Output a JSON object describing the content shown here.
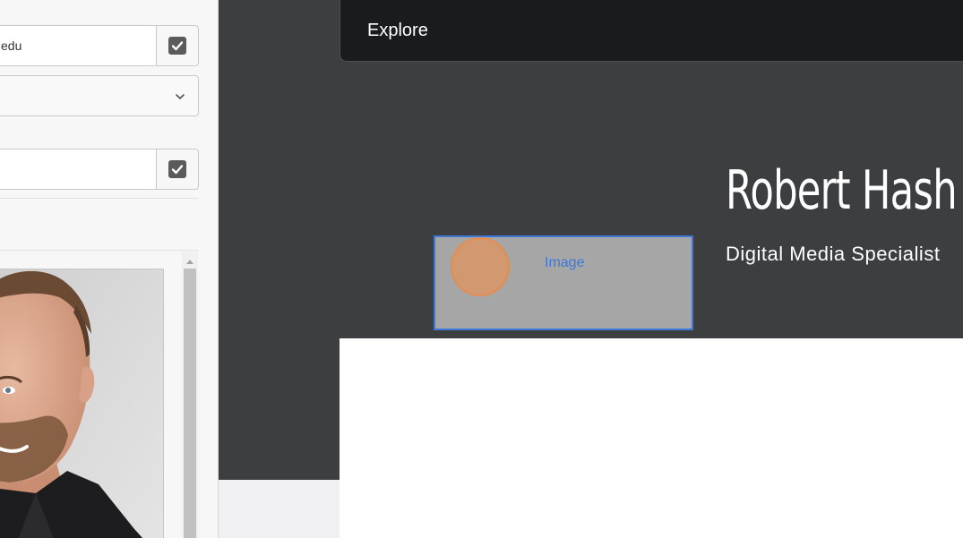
{
  "editor": {
    "email_field": {
      "value": "edu"
    },
    "second_field": {
      "value": ""
    },
    "photo": {
      "alt": "Profile photo of Robert"
    }
  },
  "preview": {
    "nav": {
      "label": "Explore"
    },
    "image_placeholder": {
      "label": "Image"
    },
    "profile": {
      "name": "Robert Hash",
      "title": "Digital Media Specialist"
    }
  },
  "colors": {
    "dark_bg": "#3d3e40",
    "nav_bg": "#1a1b1d",
    "accent_blue": "#3d78d8",
    "cursor_orange": "#ee9250"
  }
}
